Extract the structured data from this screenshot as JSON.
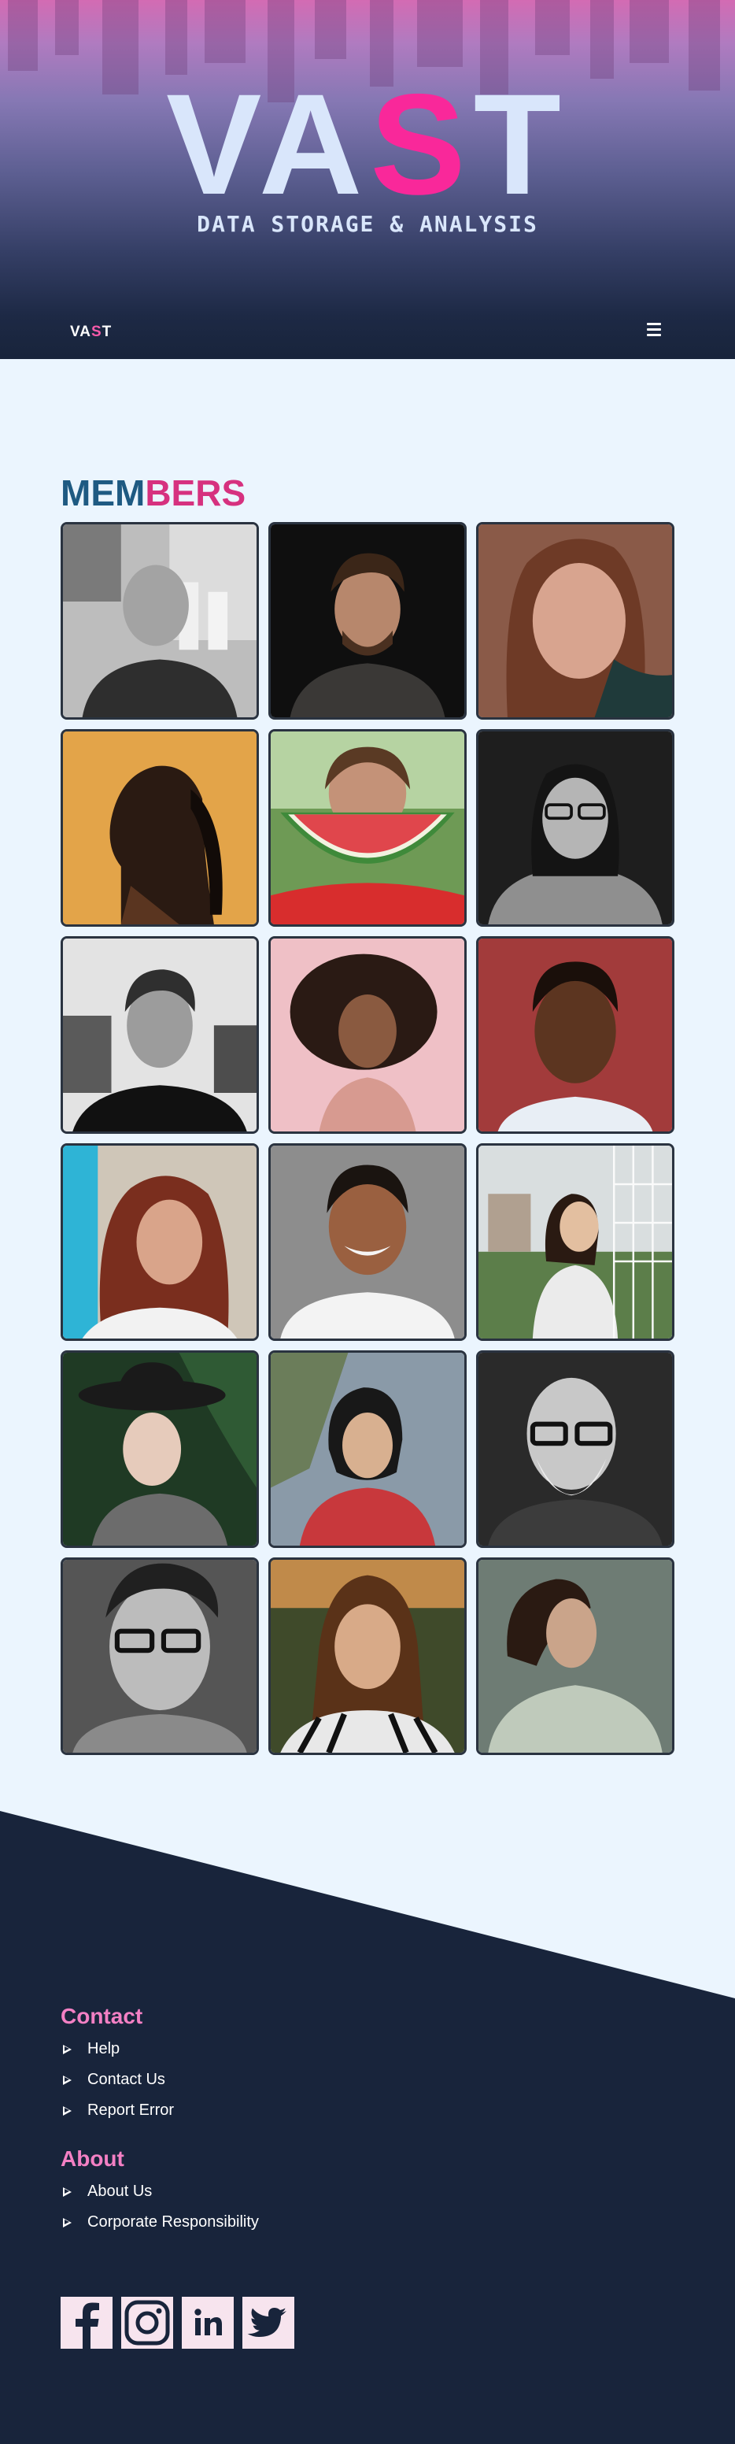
{
  "hero": {
    "title_start": "VA",
    "title_accent": "S",
    "title_end": "T",
    "subtitle": "DATA STORAGE & ANALYSIS"
  },
  "nav": {
    "logo_start": "VA",
    "logo_accent": "S",
    "logo_end": "T",
    "menu_icon": "hamburger-menu-icon"
  },
  "members": {
    "title_part1": "MEM",
    "title_part2": "BERS",
    "photos": [
      {
        "name": "bald-man-checked-shirt-portrait"
      },
      {
        "name": "bearded-man-dark-sweater-portrait"
      },
      {
        "name": "woman-auburn-hair-closeup-portrait"
      },
      {
        "name": "woman-profile-ponytail-orange-background"
      },
      {
        "name": "woman-holding-watermelon-slice"
      },
      {
        "name": "man-glasses-long-hair-monochrome"
      },
      {
        "name": "young-man-black-tshirt-monochrome"
      },
      {
        "name": "girl-curly-afro-pink-background"
      },
      {
        "name": "woman-short-hair-red-background"
      },
      {
        "name": "woman-long-red-hair-white-top"
      },
      {
        "name": "smiling-man-white-vneck"
      },
      {
        "name": "woman-white-hoodie-soccer-goal"
      },
      {
        "name": "woman-black-hat-green-leaves"
      },
      {
        "name": "woman-nose-ring-plaid-shirt"
      },
      {
        "name": "older-bald-man-glasses-beard"
      },
      {
        "name": "man-glasses-textured-monochrome"
      },
      {
        "name": "woman-long-brown-hair-sunset"
      },
      {
        "name": "man-curly-hair-looking-up"
      }
    ]
  },
  "footer": {
    "contact_heading": "Contact",
    "contact_links": [
      "Help",
      "Contact Us",
      "Report Error"
    ],
    "about_heading": "About",
    "about_links": [
      "About Us",
      "Corporate Responsibility"
    ],
    "social": [
      "facebook-icon",
      "instagram-icon",
      "linkedin-icon",
      "twitter-icon"
    ]
  },
  "colors": {
    "accent_pink": "#f9289a",
    "footer_bg": "#18243b",
    "page_bg": "#ebf5fe",
    "heading_blue": "#1e5a82",
    "heading_pink": "#d6317f",
    "footer_heading": "#f380c4"
  }
}
